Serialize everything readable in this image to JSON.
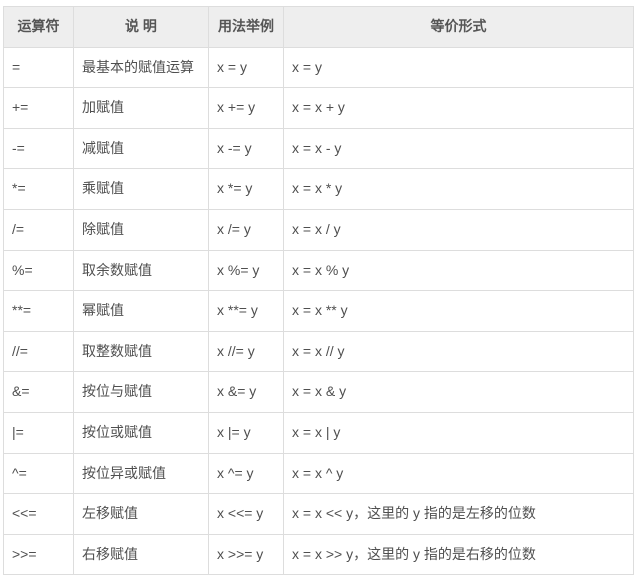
{
  "headers": {
    "operator": "运算符",
    "description": "说 明",
    "usage": "用法举例",
    "equivalent": "等价形式"
  },
  "rows": [
    {
      "op": "=",
      "desc": "最基本的赋值运算",
      "usage": "x = y",
      "equiv": "x = y"
    },
    {
      "op": "+=",
      "desc": "加赋值",
      "usage": "x += y",
      "equiv": "x = x + y"
    },
    {
      "op": "-=",
      "desc": "减赋值",
      "usage": "x -= y",
      "equiv": "x = x - y"
    },
    {
      "op": "*=",
      "desc": "乘赋值",
      "usage": "x *= y",
      "equiv": "x = x * y"
    },
    {
      "op": "/=",
      "desc": "除赋值",
      "usage": "x /= y",
      "equiv": "x = x / y"
    },
    {
      "op": "%=",
      "desc": "取余数赋值",
      "usage": "x %= y",
      "equiv": "x = x % y"
    },
    {
      "op": "**=",
      "desc": "幂赋值",
      "usage": "x **= y",
      "equiv": "x = x ** y"
    },
    {
      "op": "//=",
      "desc": "取整数赋值",
      "usage": "x //= y",
      "equiv": "x = x // y"
    },
    {
      "op": "&=",
      "desc": "按位与赋值",
      "usage": "x &= y",
      "equiv": "x = x & y"
    },
    {
      "op": "|=",
      "desc": "按位或赋值",
      "usage": "x |= y",
      "equiv": "x = x | y"
    },
    {
      "op": "^=",
      "desc": "按位异或赋值",
      "usage": "x ^= y",
      "equiv": "x = x ^ y"
    },
    {
      "op": "<<=",
      "desc": "左移赋值",
      "usage": "x <<= y",
      "equiv": "x = x << y，这里的 y 指的是左移的位数"
    },
    {
      "op": ">>=",
      "desc": "右移赋值",
      "usage": "x >>= y",
      "equiv": "x = x >> y，这里的 y 指的是右移的位数"
    }
  ]
}
